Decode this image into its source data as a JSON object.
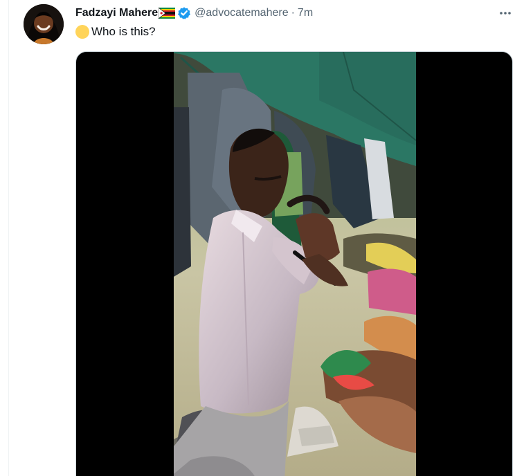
{
  "tweet": {
    "author": {
      "display_name": "Fadzayi Mahere",
      "handle": "@advocatemahere",
      "verified_icon": "verified-badge-icon",
      "flag_icon": "zimbabwe-flag-icon"
    },
    "separator": "·",
    "timestamp": "7m",
    "more_icon": "more-options-icon",
    "text_emoji": "yellow-circle-icon",
    "text": "Who is this?",
    "media": {
      "type": "video",
      "description_icon": "video-thumbnail"
    }
  },
  "colors": {
    "primary_text": "#0f1419",
    "secondary_text": "#536471",
    "verified_blue": "#1d9bf0",
    "media_background": "#000000",
    "yellow_emoji": "#ffd45a"
  }
}
